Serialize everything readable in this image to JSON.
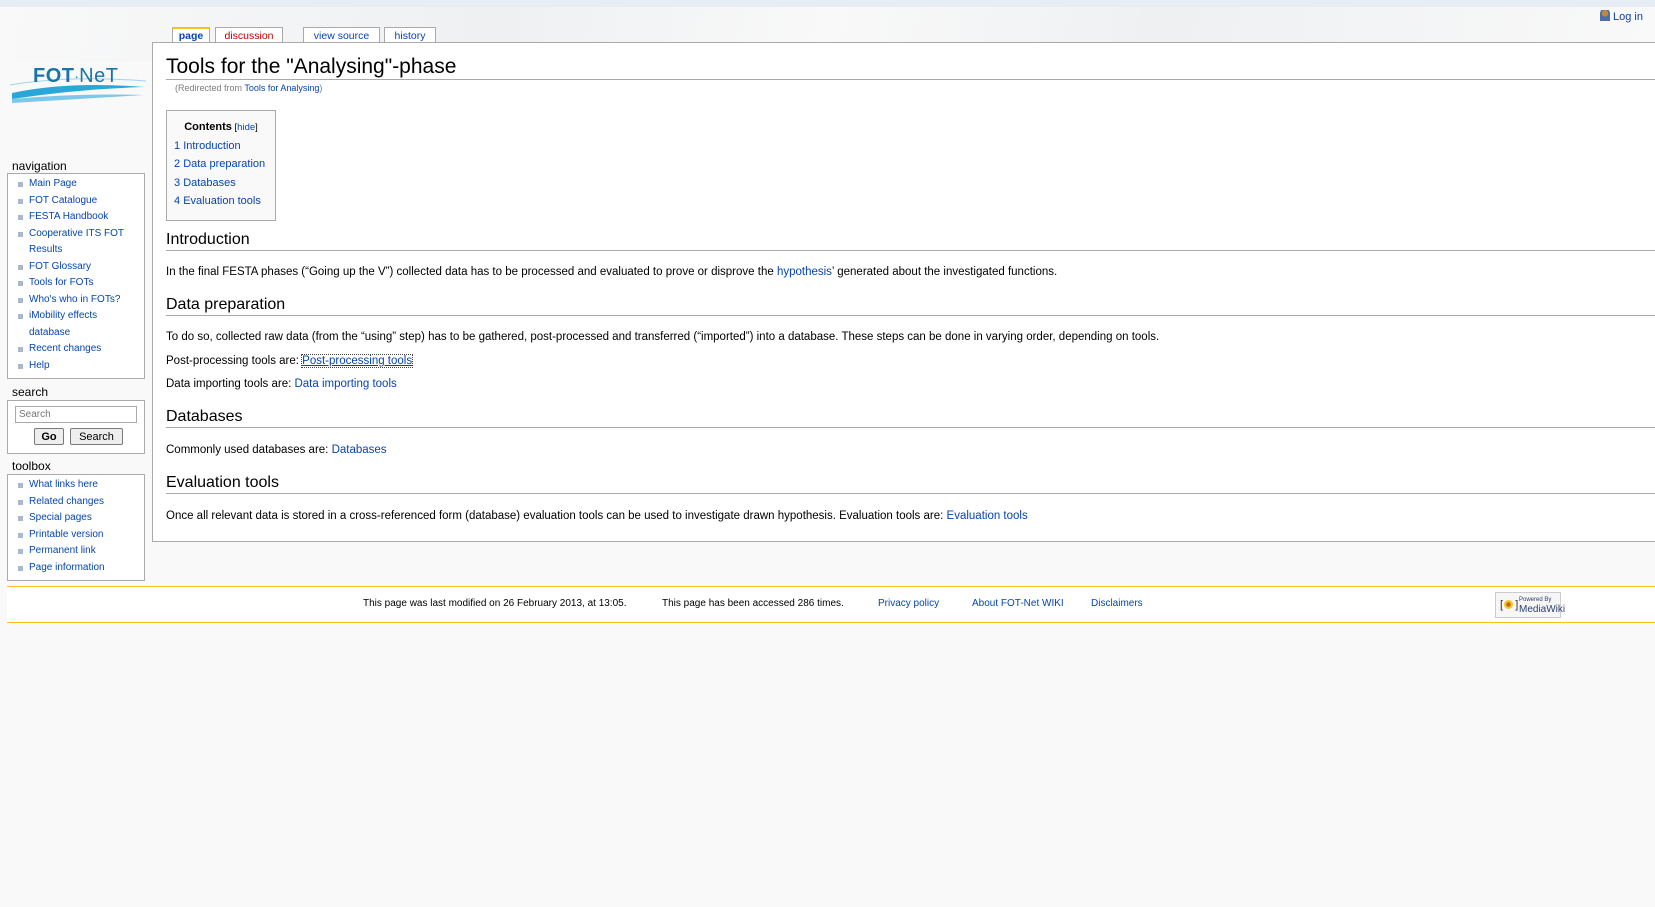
{
  "personal": {
    "login": "Log in"
  },
  "tabs": [
    {
      "label": "page",
      "state": "selected"
    },
    {
      "label": "discussion",
      "state": "new"
    },
    {
      "label": "view source",
      "state": "normal"
    },
    {
      "label": "history",
      "state": "normal"
    }
  ],
  "logo": {
    "text_bold": "FOT",
    "text_rest": "NeT"
  },
  "navigation": {
    "heading": "navigation",
    "items": [
      {
        "label": "Main Page"
      },
      {
        "label": "FOT Catalogue"
      },
      {
        "label": "FESTA Handbook"
      },
      {
        "label": "Cooperative ITS FOT"
      },
      {
        "label": "Results"
      },
      {
        "label": "FOT Glossary"
      },
      {
        "label": "Tools for FOTs"
      },
      {
        "label": "Who's who in FOTs?"
      },
      {
        "label": "iMobility effects"
      },
      {
        "label": "database"
      },
      {
        "label": "Recent changes"
      },
      {
        "label": "Help"
      }
    ]
  },
  "search": {
    "heading": "search",
    "placeholder": "Search",
    "go_label": "Go",
    "search_label": "Search"
  },
  "toolbox": {
    "heading": "toolbox",
    "items": [
      {
        "label": "What links here"
      },
      {
        "label": "Related changes"
      },
      {
        "label": "Special pages"
      },
      {
        "label": "Printable version"
      },
      {
        "label": "Permanent link"
      },
      {
        "label": "Page information"
      }
    ]
  },
  "article": {
    "title": "Tools for the \"Analysing\"-phase",
    "redirect_prefix": "(Redirected from ",
    "redirect_link": "Tools for Analysing",
    "redirect_suffix": ")",
    "toc": {
      "title": "Contents",
      "hide_open": " [",
      "hide": "hide",
      "hide_close": "]",
      "items": [
        {
          "num": "1",
          "label": "Introduction"
        },
        {
          "num": "2",
          "label": "Data preparation"
        },
        {
          "num": "3",
          "label": "Databases"
        },
        {
          "num": "4",
          "label": "Evaluation tools"
        }
      ]
    },
    "sections": {
      "intro": {
        "heading": "Introduction",
        "text_before": "In the final FESTA phases (“Going up the V”) collected data has to be processed and evaluated to prove or disprove the ",
        "link": "hypothesis",
        "text_after": "’ generated about the investigated functions."
      },
      "prep": {
        "heading": "Data preparation",
        "text": "To do so, collected raw data (from the “using” step) has to be gathered, post-processed and transferred (“imported”) into a database. These steps can be done in varying order, depending on tools.",
        "post_label": "Post-processing tools are: ",
        "post_link": "Post-processing tools",
        "import_label": "Data importing tools are: ",
        "import_link": "Data importing tools"
      },
      "db": {
        "heading": "Databases",
        "label": "Commonly used databases are: ",
        "link": "Databases"
      },
      "eval": {
        "heading": "Evaluation tools",
        "text": "Once all relevant data is stored in a cross-referenced form (database) evaluation tools can be used to investigate drawn hypothesis. Evaluation tools are: ",
        "link": "Evaluation tools"
      }
    }
  },
  "footer": {
    "lastmod": "This page was last modified on 26 February 2013, at 13:05.",
    "viewcount": "This page has been accessed 286 times.",
    "privacy": "Privacy policy",
    "about": "About FOT-Net WIKI",
    "disclaimers": "Disclaimers",
    "powered_small": "Powered By",
    "powered_big": "MediaWiki"
  }
}
